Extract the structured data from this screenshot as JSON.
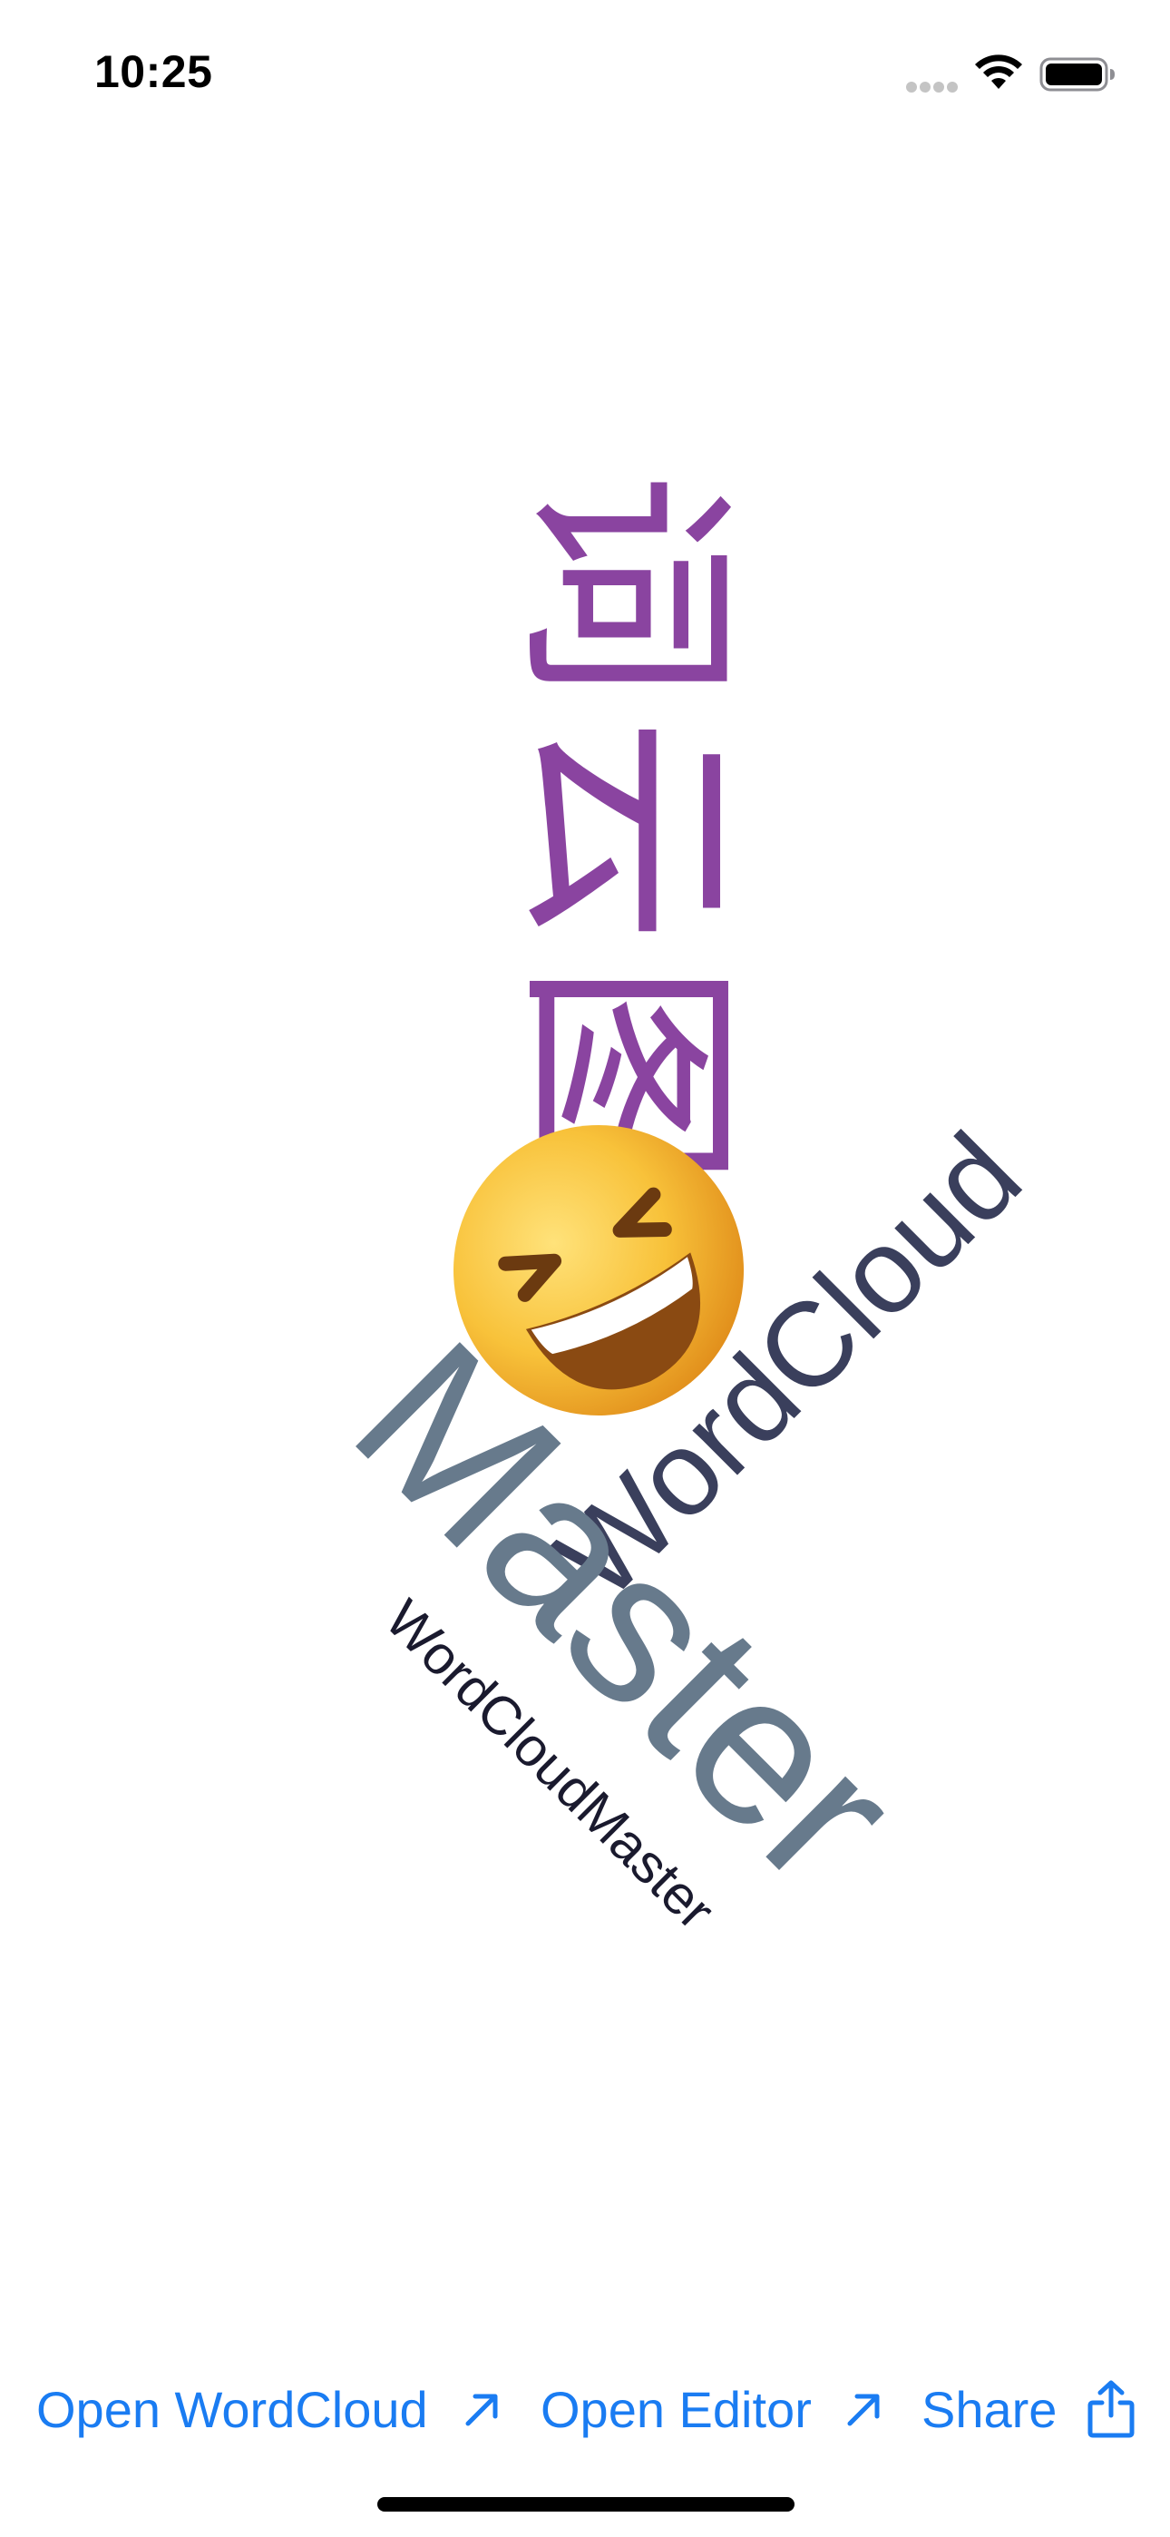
{
  "status_bar": {
    "time": "10:25"
  },
  "word_cloud": {
    "words": [
      {
        "text": "词云图",
        "color": "#8a44a0",
        "orientation": "vertical"
      },
      {
        "text": "🤣",
        "icon": "rolling-on-floor-laughing-emoji"
      },
      {
        "text": "WordCloud",
        "color": "#3a3f5c",
        "orientation": "diagonal-up"
      },
      {
        "text": "Master",
        "color": "#677a8c",
        "orientation": "diagonal-down"
      },
      {
        "text": "WordCloudMaster",
        "color": "#1a1a2e",
        "orientation": "diagonal-down"
      }
    ]
  },
  "toolbar": {
    "open_wordcloud_label": "Open WordCloud",
    "open_wordcloud_icon": "arrow-up-right-icon",
    "open_editor_label": "Open Editor",
    "open_editor_icon": "arrow-up-right-icon",
    "share_label": "Share",
    "share_icon": "share-icon",
    "accent_color": "#1a7cf2"
  }
}
